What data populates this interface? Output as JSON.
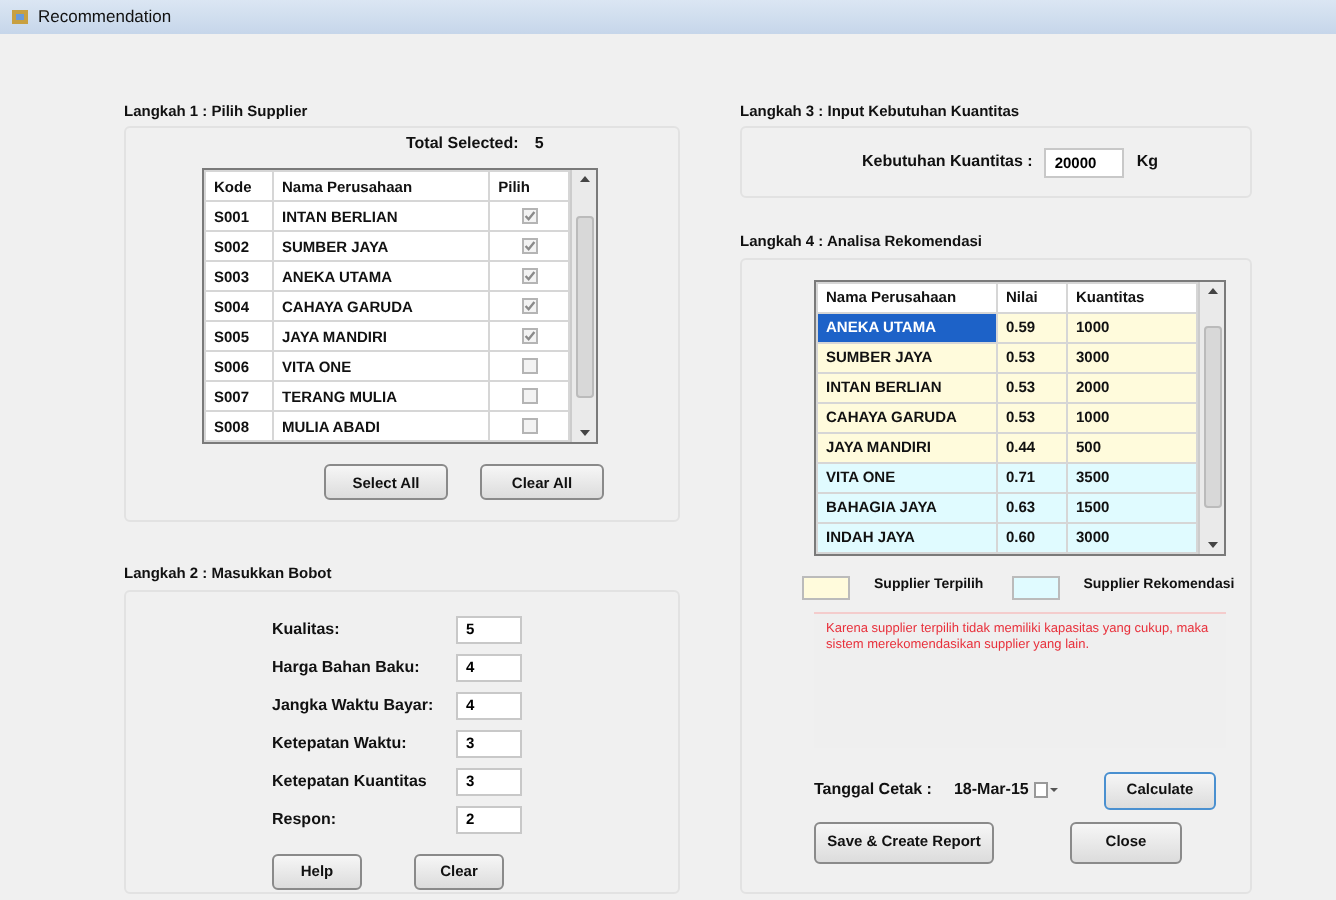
{
  "window": {
    "title": "Recommendation"
  },
  "step1": {
    "title": "Langkah 1 : Pilih Supplier",
    "total_label": "Total Selected:",
    "total_value": "5",
    "columns": [
      "Kode",
      "Nama Perusahaan",
      "Pilih"
    ],
    "rows": [
      {
        "kode": "S001",
        "nama": "INTAN BERLIAN",
        "checked": true
      },
      {
        "kode": "S002",
        "nama": "SUMBER JAYA",
        "checked": true
      },
      {
        "kode": "S003",
        "nama": "ANEKA UTAMA",
        "checked": true
      },
      {
        "kode": "S004",
        "nama": "CAHAYA GARUDA",
        "checked": true
      },
      {
        "kode": "S005",
        "nama": "JAYA MANDIRI",
        "checked": true
      },
      {
        "kode": "S006",
        "nama": "VITA ONE",
        "checked": false
      },
      {
        "kode": "S007",
        "nama": "TERANG MULIA",
        "checked": false
      },
      {
        "kode": "S008",
        "nama": "MULIA ABADI",
        "checked": false
      }
    ],
    "buttons": [
      "Select All",
      "Clear All"
    ]
  },
  "step2": {
    "title": "Langkah 2 : Masukkan Bobot",
    "fields": [
      {
        "label": "Kualitas:",
        "value": "5"
      },
      {
        "label": "Harga Bahan Baku:",
        "value": "4"
      },
      {
        "label": "Jangka Waktu Bayar:",
        "value": "4"
      },
      {
        "label": "Ketepatan Waktu:",
        "value": "3"
      },
      {
        "label": "Ketepatan Kuantitas",
        "value": "3"
      },
      {
        "label": "Respon:",
        "value": "2"
      }
    ],
    "buttons": [
      "Help",
      "Clear"
    ]
  },
  "step3": {
    "title": "Langkah 3 : Input Kebutuhan Kuantitas",
    "label": "Kebutuhan Kuantitas :",
    "value": "20000",
    "unit": "Kg"
  },
  "step4": {
    "title": "Langkah 4 : Analisa Rekomendasi",
    "columns": [
      "Nama Perusahaan",
      "Nilai",
      "Kuantitas"
    ],
    "rows": [
      {
        "nama": "ANEKA UTAMA",
        "nilai": "0.59",
        "kuantitas": "1000",
        "color": "#fffbdc",
        "selected": true
      },
      {
        "nama": "SUMBER JAYA",
        "nilai": "0.53",
        "kuantitas": "3000",
        "color": "#fffbdc",
        "selected": false
      },
      {
        "nama": "INTAN BERLIAN",
        "nilai": "0.53",
        "kuantitas": "2000",
        "color": "#fffbdc",
        "selected": false
      },
      {
        "nama": "CAHAYA GARUDA",
        "nilai": "0.53",
        "kuantitas": "1000",
        "color": "#fffbdc",
        "selected": false
      },
      {
        "nama": "JAYA MANDIRI",
        "nilai": "0.44",
        "kuantitas": "500",
        "color": "#fffbdc",
        "selected": false
      },
      {
        "nama": "VITA ONE",
        "nilai": "0.71",
        "kuantitas": "3500",
        "color": "#e0fbff",
        "selected": false
      },
      {
        "nama": "BAHAGIA JAYA",
        "nilai": "0.63",
        "kuantitas": "1500",
        "color": "#e0fbff",
        "selected": false
      },
      {
        "nama": "INDAH JAYA",
        "nilai": "0.60",
        "kuantitas": "3000",
        "color": "#e0fbff",
        "selected": false
      }
    ],
    "legend": [
      {
        "label": "Supplier Terpilih",
        "color": "#fffbdc"
      },
      {
        "label": "Supplier Rekomendasi",
        "color": "#e0fbff"
      }
    ],
    "message": "Karena supplier terpilih tidak memiliki kapasitas yang cukup, maka sistem merekomendasikan supplier yang lain.",
    "date_label": "Tanggal Cetak :",
    "date_value": "18-Mar-15",
    "calculate_button": "Calculate",
    "buttons": [
      "Save & Create Report",
      "Close"
    ]
  }
}
